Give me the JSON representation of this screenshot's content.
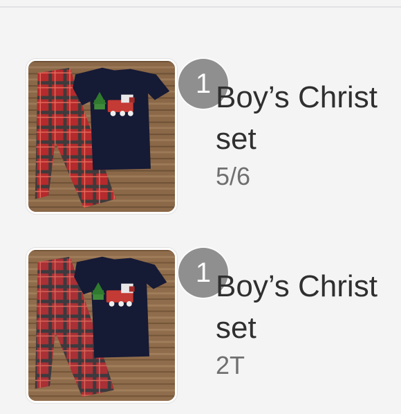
{
  "items": [
    {
      "title": "Boy’s Christ set",
      "size": "5/6",
      "quantity": "1",
      "thumbnail_icon": "plaid-pajama-set-photo"
    },
    {
      "title": "Boy’s Christ set",
      "size": "2T",
      "quantity": "1",
      "thumbnail_icon": "plaid-pajama-set-photo"
    }
  ],
  "colors": {
    "background": "#f4f4f5",
    "badge": "#8f8f8f",
    "title": "#2f2f2f",
    "size": "#6f6f6f"
  }
}
